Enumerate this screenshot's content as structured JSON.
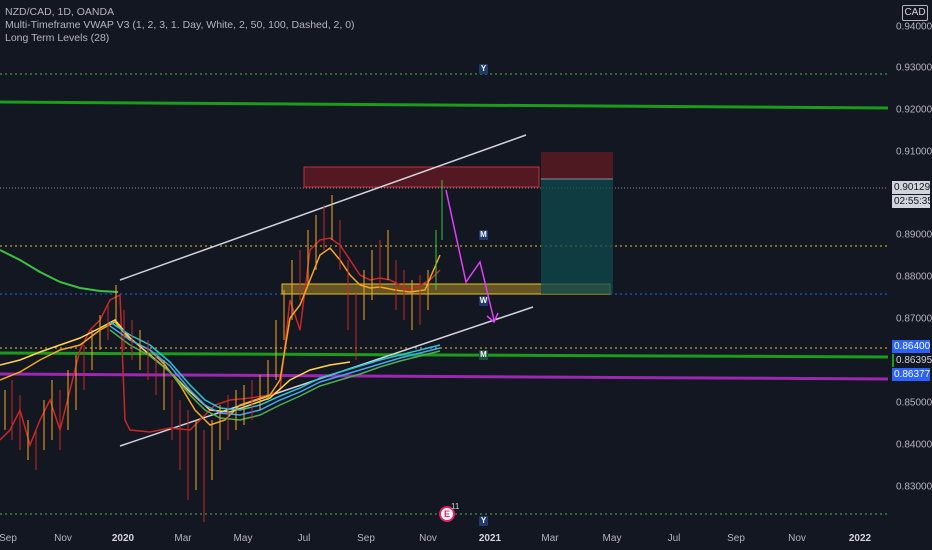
{
  "legend": {
    "symbol_line": "NZD/CAD, 1D, OANDA",
    "indicator_1": "Multi-Timeframe VWAP V3 (1, 2, 3, 1. Day, White, 2, 50, 100, Dashed, 2, 0)",
    "indicator_2": "Long Term Levels (28)"
  },
  "price_scale": {
    "currency": "CAD",
    "ticks": [
      "0.94000",
      "0.93000",
      "0.92000",
      "0.91000",
      "0.89000",
      "0.88000",
      "0.87000",
      "0.85000",
      "0.84000",
      "0.83000"
    ],
    "last_price": "0.90129",
    "countdown": "02:55:35",
    "label_blue": "0.86400",
    "label_green": "0.86395",
    "label_purple": "0.86377"
  },
  "time_scale": {
    "labels": [
      "Sep",
      "Nov",
      "2020",
      "Mar",
      "May",
      "Jul",
      "Sep",
      "Nov",
      "2021",
      "Mar",
      "May",
      "Jul",
      "Sep",
      "Nov",
      "2022"
    ]
  },
  "markers": {
    "y_top": "Y",
    "m_mid": "M",
    "w_mid": "W",
    "m_low": "M",
    "y_bottom": "Y"
  },
  "event": {
    "icon": "earnings-icon",
    "count": "11"
  },
  "colors": {
    "background": "#131722",
    "level_green": "#1b9c1b",
    "level_purple": "#9c27b0",
    "zone_red": "#8b1a22",
    "zone_yellow": "#c9a227",
    "projection_magenta": "#e040fb",
    "position_teal": "#0e4a4c"
  }
}
